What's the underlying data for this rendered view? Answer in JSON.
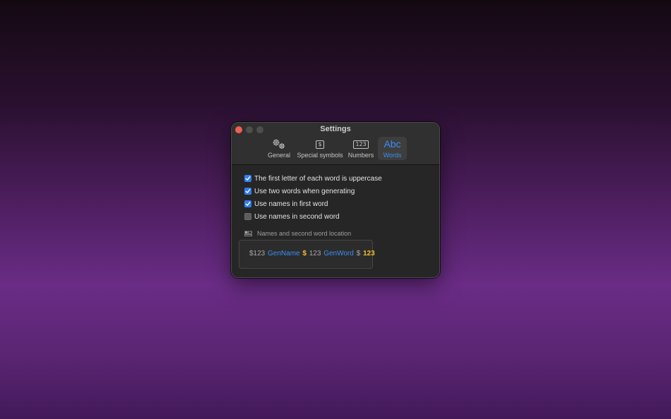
{
  "window": {
    "title": "Settings"
  },
  "tabs": [
    {
      "label": "General",
      "icon": "gears-icon",
      "selected": false
    },
    {
      "label": "Special symbols",
      "icon": "dollar-box-icon",
      "glyph": "$",
      "selected": false
    },
    {
      "label": "Numbers",
      "icon": "numbers-box-icon",
      "glyph": "123",
      "selected": false
    },
    {
      "label": "Words",
      "icon": "abc-icon",
      "glyph": "Abc",
      "selected": true
    }
  ],
  "options": [
    {
      "label": "The first letter of each word is uppercase",
      "checked": true
    },
    {
      "label": "Use two words when generating",
      "checked": true
    },
    {
      "label": "Use names in first word",
      "checked": true
    },
    {
      "label": "Use names in second word",
      "checked": false
    }
  ],
  "location": {
    "label": "Names and second word location",
    "tokens": [
      {
        "text": "$123",
        "style": "gray"
      },
      {
        "text": "GenName",
        "style": "blue"
      },
      {
        "text": "$",
        "style": "yellow"
      },
      {
        "text": "123",
        "style": "gray"
      },
      {
        "text": "GenWord",
        "style": "blue"
      },
      {
        "text": "$",
        "style": "gray"
      },
      {
        "text": "123",
        "style": "yellow"
      }
    ]
  },
  "colors": {
    "accent": "#3c8ef5",
    "highlight": "#f2be2e",
    "close": "#ed5f57"
  }
}
